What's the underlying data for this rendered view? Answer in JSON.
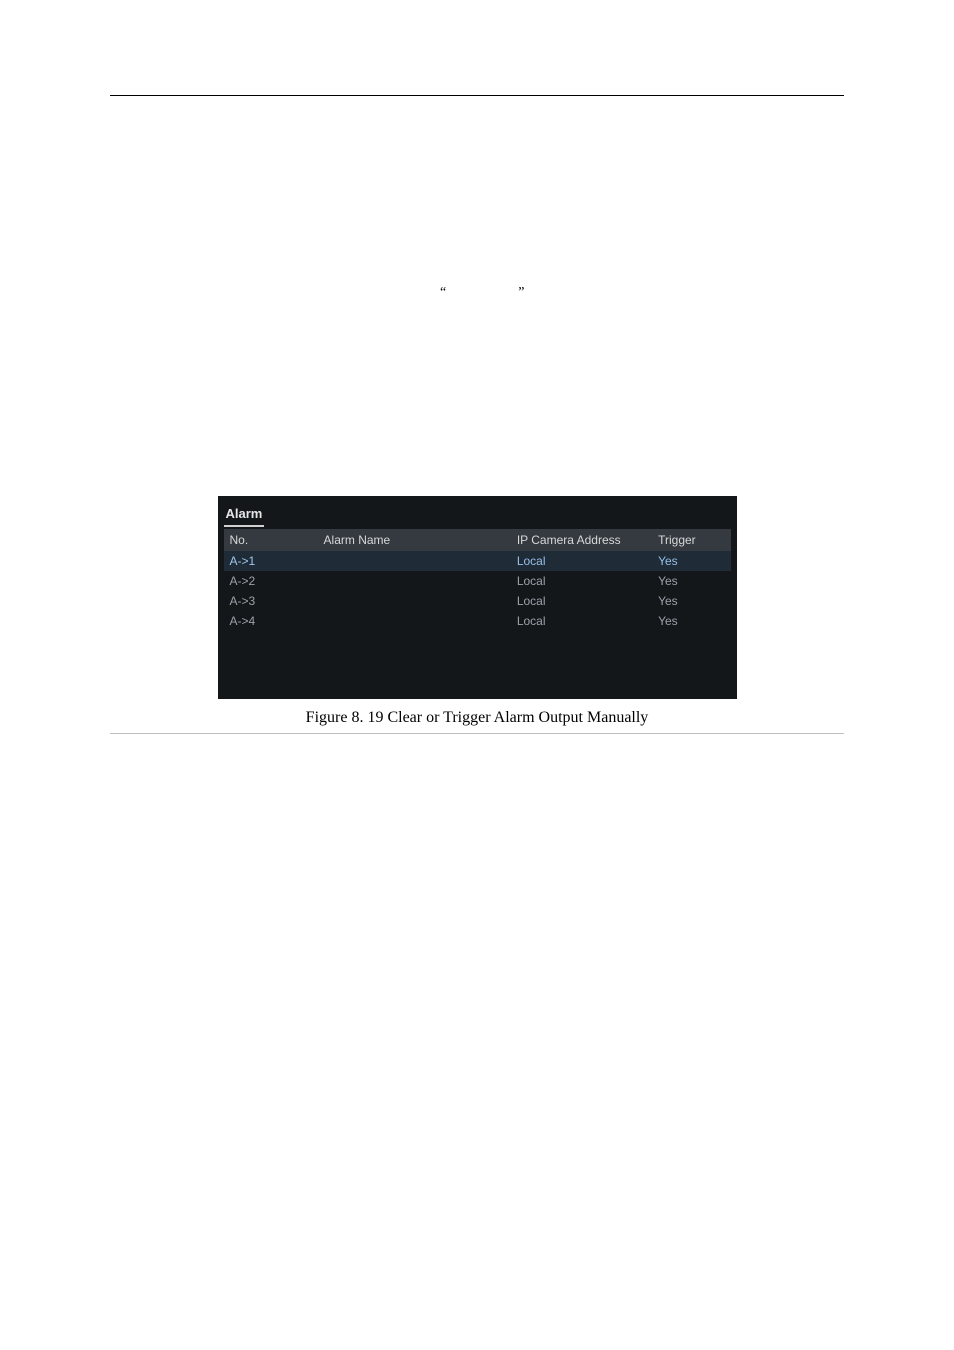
{
  "quotes": {
    "left": "“",
    "right": "”"
  },
  "ui": {
    "tab": "Alarm",
    "headers": {
      "no": "No.",
      "name": "Alarm Name",
      "addr": "IP Camera Address",
      "trig": "Trigger"
    },
    "rows": [
      {
        "no": "A->1",
        "name": "",
        "addr": "Local",
        "trig": "Yes",
        "selected": true
      },
      {
        "no": "A->2",
        "name": "",
        "addr": "Local",
        "trig": "Yes",
        "selected": false
      },
      {
        "no": "A->3",
        "name": "",
        "addr": "Local",
        "trig": "Yes",
        "selected": false
      },
      {
        "no": "A->4",
        "name": "",
        "addr": "Local",
        "trig": "Yes",
        "selected": false
      }
    ]
  },
  "caption": "Figure 8. 19 Clear or Trigger Alarm Output Manually"
}
